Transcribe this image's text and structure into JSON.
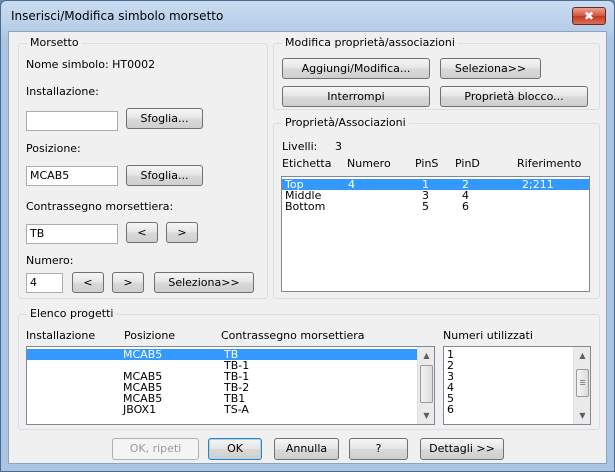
{
  "window": {
    "title": "Inserisci/Modifica simbolo morsetto",
    "close_glyph": "✖"
  },
  "morsetto": {
    "group_title": "Morsetto",
    "nome_simbolo": "Nome simbolo: HT0002",
    "installazione_label": "Installazione:",
    "installazione_value": "",
    "posizione_label": "Posizione:",
    "posizione_value": "MCAB5",
    "contrassegno_label": "Contrassegno morsettiera:",
    "contrassegno_value": "TB",
    "numero_label": "Numero:",
    "numero_value": "4",
    "sfoglia1": "Sfoglia...",
    "sfoglia2": "Sfoglia...",
    "prev": "<",
    "next": ">",
    "num_prev": "<",
    "num_next": ">",
    "seleziona": "Seleziona>>"
  },
  "modifica": {
    "group_title": "Modifica proprietà/associazioni",
    "aggiungi": "Aggiungi/Modifica...",
    "seleziona": "Seleziona>>",
    "interrompi": "Interrompi",
    "proprieta_blocco": "Proprietà blocco..."
  },
  "proprieta": {
    "group_title": "Proprietà/Associazioni",
    "livelli_label": "Livelli:",
    "livelli_value": "3",
    "headers": [
      "Etichetta",
      "Numero",
      "PinS",
      "PinD",
      "Riferimento"
    ],
    "rows": [
      {
        "etichetta": "Top",
        "numero": "4",
        "pins": "1",
        "pind": "2",
        "riferimento": "2;211"
      },
      {
        "etichetta": "Middle",
        "numero": "",
        "pins": "3",
        "pind": "4",
        "riferimento": ""
      },
      {
        "etichetta": "Bottom",
        "numero": "",
        "pins": "5",
        "pind": "6",
        "riferimento": ""
      }
    ],
    "selected_row": 0
  },
  "progetti": {
    "group_title": "Elenco progetti",
    "headers": [
      "Installazione",
      "Posizione",
      "Contrassegno morsettiera"
    ],
    "rows": [
      {
        "installazione": "",
        "posizione": "MCAB5",
        "contrassegno": "TB"
      },
      {
        "installazione": "",
        "posizione": "",
        "contrassegno": "TB-1"
      },
      {
        "installazione": "",
        "posizione": "MCAB5",
        "contrassegno": "TB-1"
      },
      {
        "installazione": "",
        "posizione": "MCAB5",
        "contrassegno": "TB-2"
      },
      {
        "installazione": "",
        "posizione": "MCAB5",
        "contrassegno": "TB1"
      },
      {
        "installazione": "",
        "posizione": "JBOX1",
        "contrassegno": "TS-A"
      }
    ],
    "selected_row": 0,
    "numeri_label": "Numeri utilizzati",
    "numeri": [
      "1",
      "2",
      "3",
      "4",
      "5",
      "6"
    ]
  },
  "footer": {
    "ok_ripeti": "OK, ripeti",
    "ok": "OK",
    "annulla": "Annulla",
    "help": "?",
    "dettagli": "Dettagli >>"
  },
  "icons": {
    "up_arrow": "▲",
    "down_arrow": "▼"
  }
}
